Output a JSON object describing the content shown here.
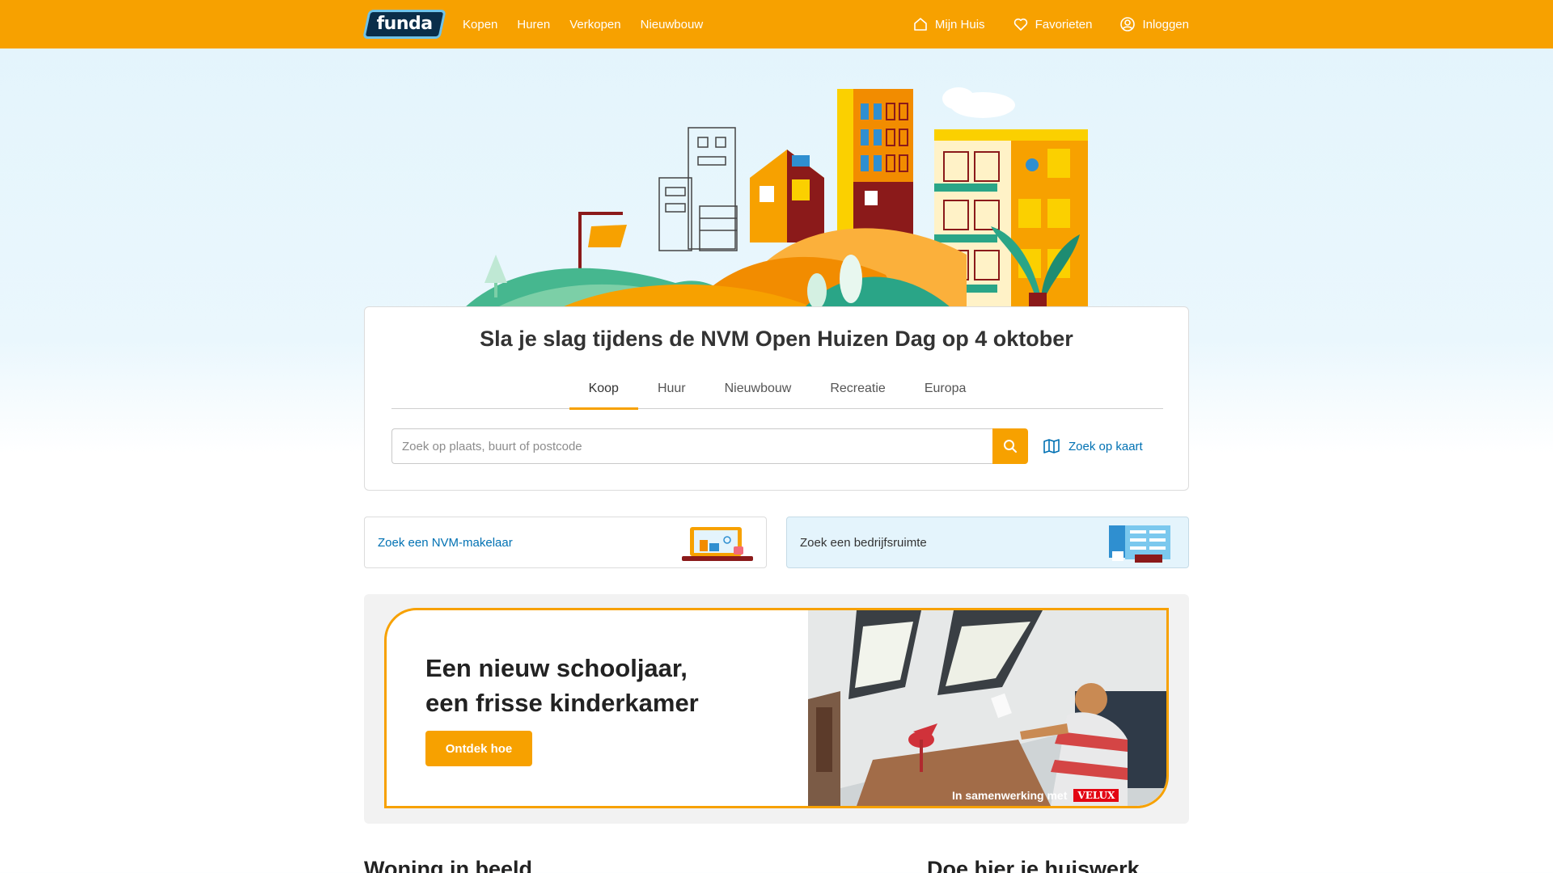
{
  "header": {
    "logo_text": "funda",
    "nav_left": [
      "Kopen",
      "Huren",
      "Verkopen",
      "Nieuwbouw"
    ],
    "nav_right": [
      {
        "label": "Mijn Huis",
        "icon": "house-icon"
      },
      {
        "label": "Favorieten",
        "icon": "heart-icon"
      },
      {
        "label": "Inloggen",
        "icon": "user-icon"
      }
    ],
    "accent_color": "#f7a100"
  },
  "search": {
    "title": "Sla je slag tijdens de NVM Open Huizen Dag op 4 oktober",
    "tabs": [
      "Koop",
      "Huur",
      "Nieuwbouw",
      "Recreatie",
      "Europa"
    ],
    "active_tab": "Koop",
    "placeholder": "Zoek op plaats, buurt of postcode",
    "map_link": "Zoek op kaart"
  },
  "cards": {
    "nvm": "Zoek een NVM-makelaar",
    "bedrijf": "Zoek een bedrijfsruimte"
  },
  "promo": {
    "title_line1": "Een nieuw schooljaar,",
    "title_line2": "een frisse kinderkamer",
    "button": "Ontdek hoe",
    "partner_note": "In samenwerking met",
    "partner_logo": "VELUX"
  },
  "sections": {
    "left": "Woning in beeld",
    "right": "Doe hier je huiswerk"
  }
}
